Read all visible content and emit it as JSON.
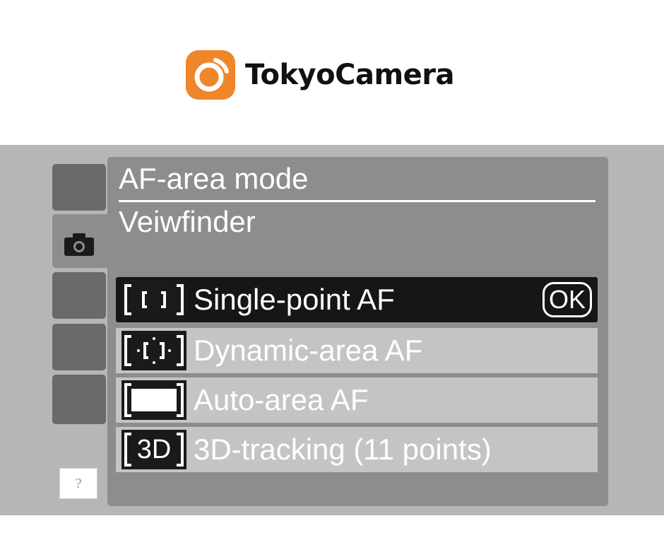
{
  "brand": {
    "name": "TokyoCamera",
    "logo_icon": "camera-lens-logo-icon",
    "accent": "#f0862a"
  },
  "sidebar": {
    "active_icon": "camera-icon",
    "help_label": "?"
  },
  "menu": {
    "title": "AF-area mode",
    "subtitle": "Veiwfinder",
    "options": [
      {
        "icon": "single-point-af-icon",
        "label": "Single-point AF",
        "selected": true,
        "confirm": "OK"
      },
      {
        "icon": "dynamic-area-af-icon",
        "label": "Dynamic-area AF",
        "selected": false
      },
      {
        "icon": "auto-area-af-icon",
        "label": "Auto-area AF",
        "selected": false
      },
      {
        "icon": "3d-tracking-icon",
        "icon_text": "3D",
        "label": "3D-tracking (11 points)",
        "selected": false
      }
    ]
  },
  "colors": {
    "screen_bg": "#b6b6b6",
    "panel": "#8d8d8d",
    "selected_row": "#161616",
    "row": "#c4c4c4"
  }
}
